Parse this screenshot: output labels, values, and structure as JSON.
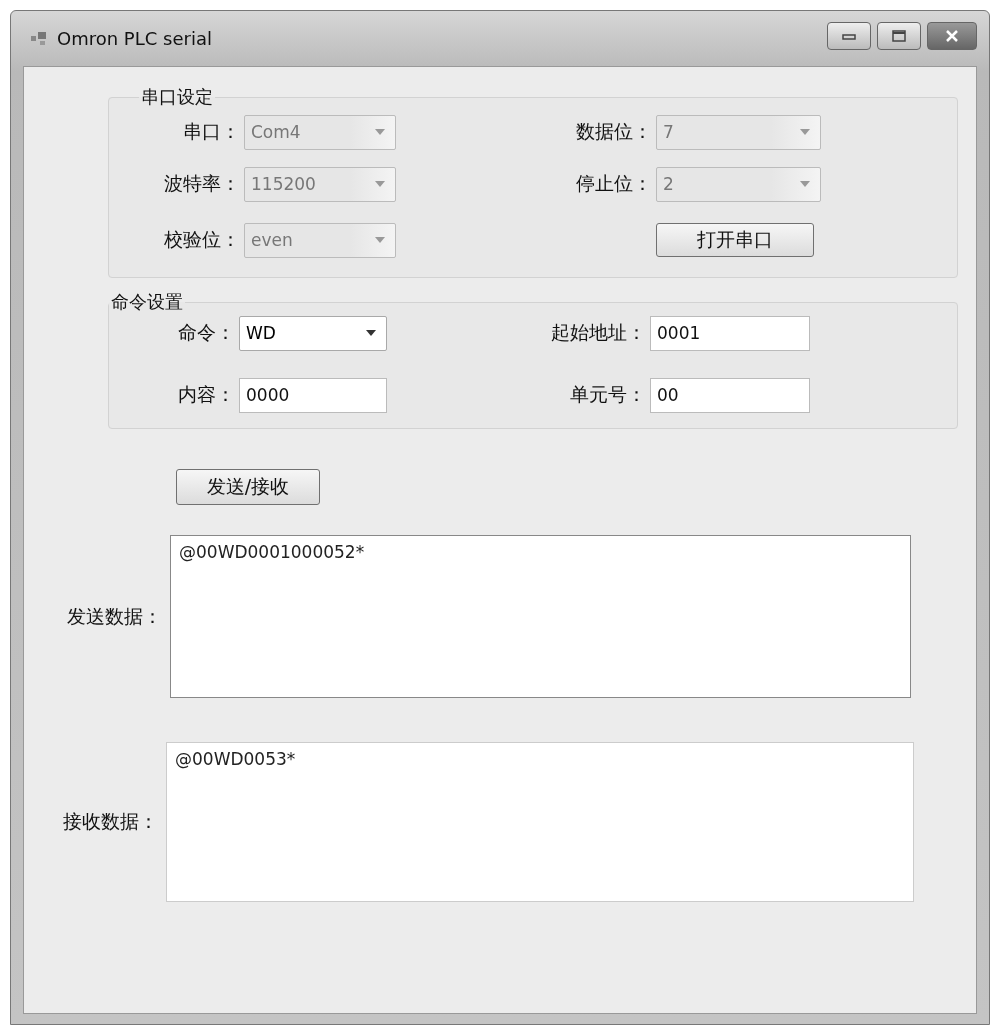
{
  "window": {
    "title": "Omron PLC serial"
  },
  "serial_settings": {
    "title": "串口设定",
    "left": [
      {
        "label": "串口：",
        "kind": "dropdown",
        "value": "Com4",
        "disabled": true
      },
      {
        "label": "波特率：",
        "kind": "dropdown",
        "value": "115200",
        "disabled": true
      },
      {
        "label": "校验位：",
        "kind": "dropdown",
        "value": "even",
        "disabled": true
      }
    ],
    "right": [
      {
        "label": "数据位：",
        "kind": "dropdown",
        "value": "7",
        "disabled": true
      },
      {
        "label": "停止位：",
        "kind": "dropdown",
        "value": "2",
        "disabled": true
      },
      {
        "kind": "button",
        "text": "打开串口"
      }
    ]
  },
  "command_settings": {
    "title": "命令设置",
    "left": [
      {
        "label": "命令：",
        "kind": "dropdown",
        "value": "WD",
        "disabled": false
      },
      {
        "label": "内容：",
        "kind": "text",
        "value": "0000"
      }
    ],
    "right": [
      {
        "label": "起始地址：",
        "kind": "text",
        "value": "0001"
      },
      {
        "label": "单元号：",
        "kind": "text",
        "value": "00"
      }
    ]
  },
  "send_button": "发送/接收",
  "send_data": {
    "label": "发送数据：",
    "value": "@00WD0001000052*"
  },
  "receive_data": {
    "label": "接收数据：",
    "value": "@00WD0053*"
  }
}
